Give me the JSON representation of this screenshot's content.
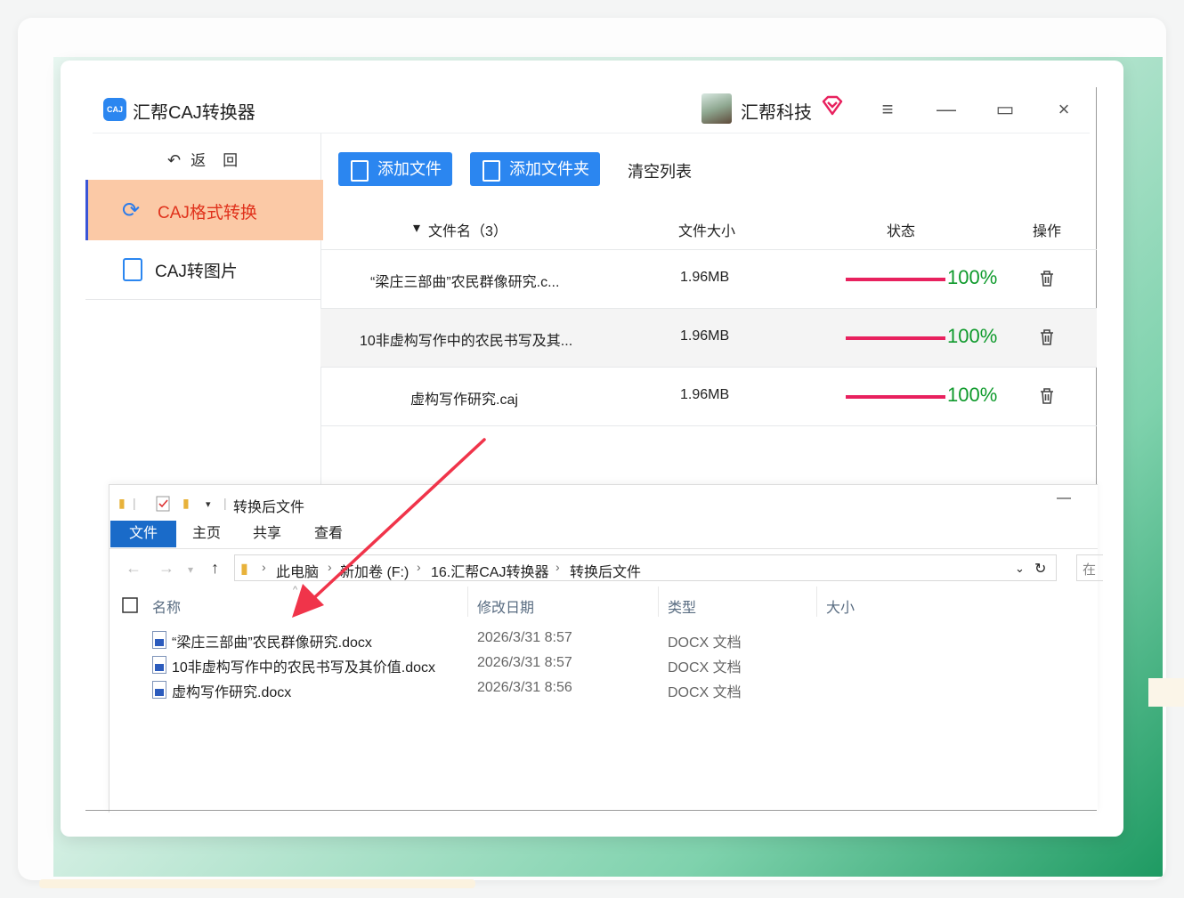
{
  "app": {
    "title": "汇帮CAJ转换器",
    "logo_text": "CAJ",
    "brand": "汇帮科技",
    "controls": {
      "menu": "≡",
      "minimize": "—",
      "maximize": "▭",
      "close": "×"
    }
  },
  "sidebar": {
    "back_label": "返　回",
    "items": [
      {
        "label": "CAJ格式转换",
        "active": true
      },
      {
        "label": "CAJ转图片",
        "active": false
      }
    ]
  },
  "toolbar": {
    "add_file": "添加文件",
    "add_folder": "添加文件夹",
    "clear_list": "清空列表"
  },
  "table": {
    "headers": {
      "name": "文件名（3）",
      "size": "文件大小",
      "status": "状态",
      "action": "操作"
    },
    "rows": [
      {
        "name": "“梁庄三部曲”农民群像研究.c...",
        "size": "1.96MB",
        "progress": 1.0,
        "percent": "100%"
      },
      {
        "name": "10非虚构写作中的农民书写及其...",
        "size": "1.96MB",
        "progress": 1.0,
        "percent": "100%"
      },
      {
        "name": "虚构写作研究.caj",
        "size": "1.96MB",
        "progress": 1.0,
        "percent": "100%"
      }
    ]
  },
  "explorer": {
    "title": "转换后文件",
    "ribbon": [
      "文件",
      "主页",
      "共享",
      "查看"
    ],
    "breadcrumb": [
      "此电脑",
      "新加卷 (F:)",
      "16.汇帮CAJ转换器",
      "转换后文件"
    ],
    "search_stub": "在",
    "columns": {
      "name": "名称",
      "date": "修改日期",
      "type": "类型",
      "size": "大小"
    },
    "files": [
      {
        "name": "“梁庄三部曲”农民群像研究.docx",
        "date": "2026/3/31 8:57",
        "type": "DOCX 文档"
      },
      {
        "name": "10非虚构写作中的农民书写及其价值.docx",
        "date": "2026/3/31 8:57",
        "type": "DOCX 文档"
      },
      {
        "name": "虚构写作研究.docx",
        "date": "2026/3/31 8:56",
        "type": "DOCX 文档"
      }
    ]
  },
  "colors": {
    "accent_blue": "#2b86f0",
    "active_nav_bg": "#fbc9a6",
    "active_nav_text": "#e0321c",
    "progress": "#e8215e",
    "percent": "#0f9a2c",
    "arrow": "#f0344a"
  }
}
